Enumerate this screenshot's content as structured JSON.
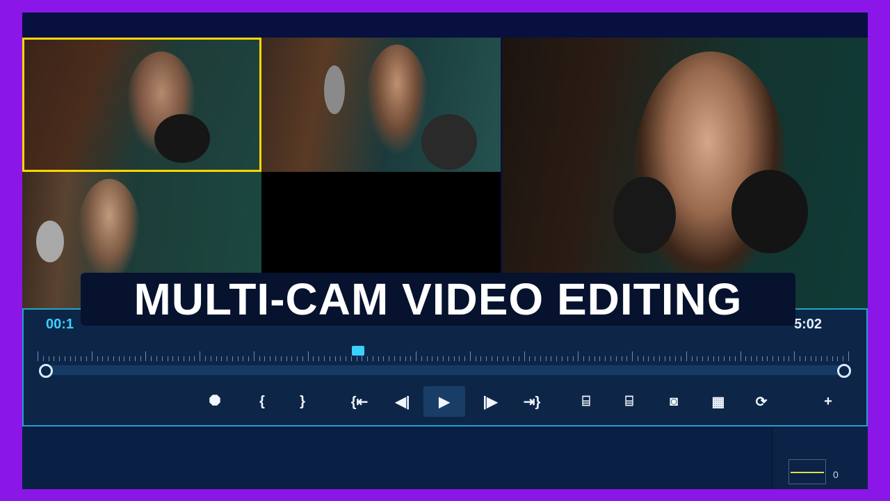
{
  "title": "MULTI-CAM VIDEO EDITING",
  "timeline": {
    "timecode_left": "00:1",
    "timecode_right": "5:02",
    "playhead_position": 0.395
  },
  "controls": [
    {
      "name": "marker-icon",
      "glyph": "⯃"
    },
    {
      "name": "mark-in-icon",
      "glyph": "{"
    },
    {
      "name": "mark-out-icon",
      "glyph": "}"
    },
    {
      "name": "go-to-start-icon",
      "glyph": "{⇤"
    },
    {
      "name": "previous-frame-icon",
      "glyph": "◀|"
    },
    {
      "name": "play-icon",
      "glyph": "▶"
    },
    {
      "name": "next-frame-icon",
      "glyph": "|▶"
    },
    {
      "name": "go-to-end-icon",
      "glyph": "⇥}"
    },
    {
      "name": "multicam-icon",
      "glyph": "⌸"
    },
    {
      "name": "multicam-split-icon",
      "glyph": "⌸"
    },
    {
      "name": "snapshot-icon",
      "glyph": "◙"
    },
    {
      "name": "film-strip-icon",
      "glyph": "▦"
    },
    {
      "name": "swap-icon",
      "glyph": "⟳"
    },
    {
      "name": "add-icon",
      "glyph": "+"
    }
  ],
  "audio_meter": {
    "value_label": "0"
  },
  "colors": {
    "frame": "#8a16e8",
    "background": "#07103f",
    "selected_camera_border": "#ffd700",
    "timecode_accent": "#3ad0ff"
  }
}
